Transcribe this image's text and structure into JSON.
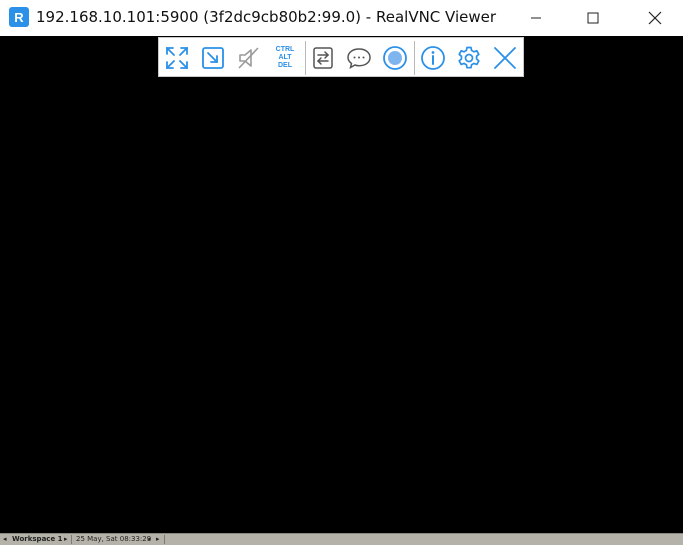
{
  "window": {
    "title": "192.168.10.101:5900 (3f2dc9cb80b2:99.0) - RealVNC Viewer",
    "logo_text": "R",
    "accent_color": "#2b90e8"
  },
  "toolbar": {
    "items": [
      {
        "name": "full-screen",
        "icon": "expand-arrows-icon"
      },
      {
        "name": "scale-to-window",
        "icon": "scale-icon"
      },
      {
        "name": "audio",
        "icon": "speaker-muted-icon"
      },
      {
        "name": "ctrl-alt-del",
        "label_lines": [
          "CTRL",
          "ALT",
          "DEL"
        ]
      },
      {
        "name": "file-transfer",
        "icon": "transfer-icon"
      },
      {
        "name": "chat",
        "icon": "chat-icon"
      },
      {
        "name": "record",
        "icon": "record-icon"
      },
      {
        "name": "info",
        "icon": "info-icon"
      },
      {
        "name": "settings",
        "icon": "gear-icon"
      },
      {
        "name": "close-toolbar",
        "icon": "close-icon"
      }
    ]
  },
  "taskbar": {
    "left_arrow": "◂",
    "workspace": "Workspace 1",
    "right_arrow": "▸",
    "datetime": "25 May, Sat 08:33:29",
    "nav_left": "◂",
    "nav_right": "▸"
  }
}
